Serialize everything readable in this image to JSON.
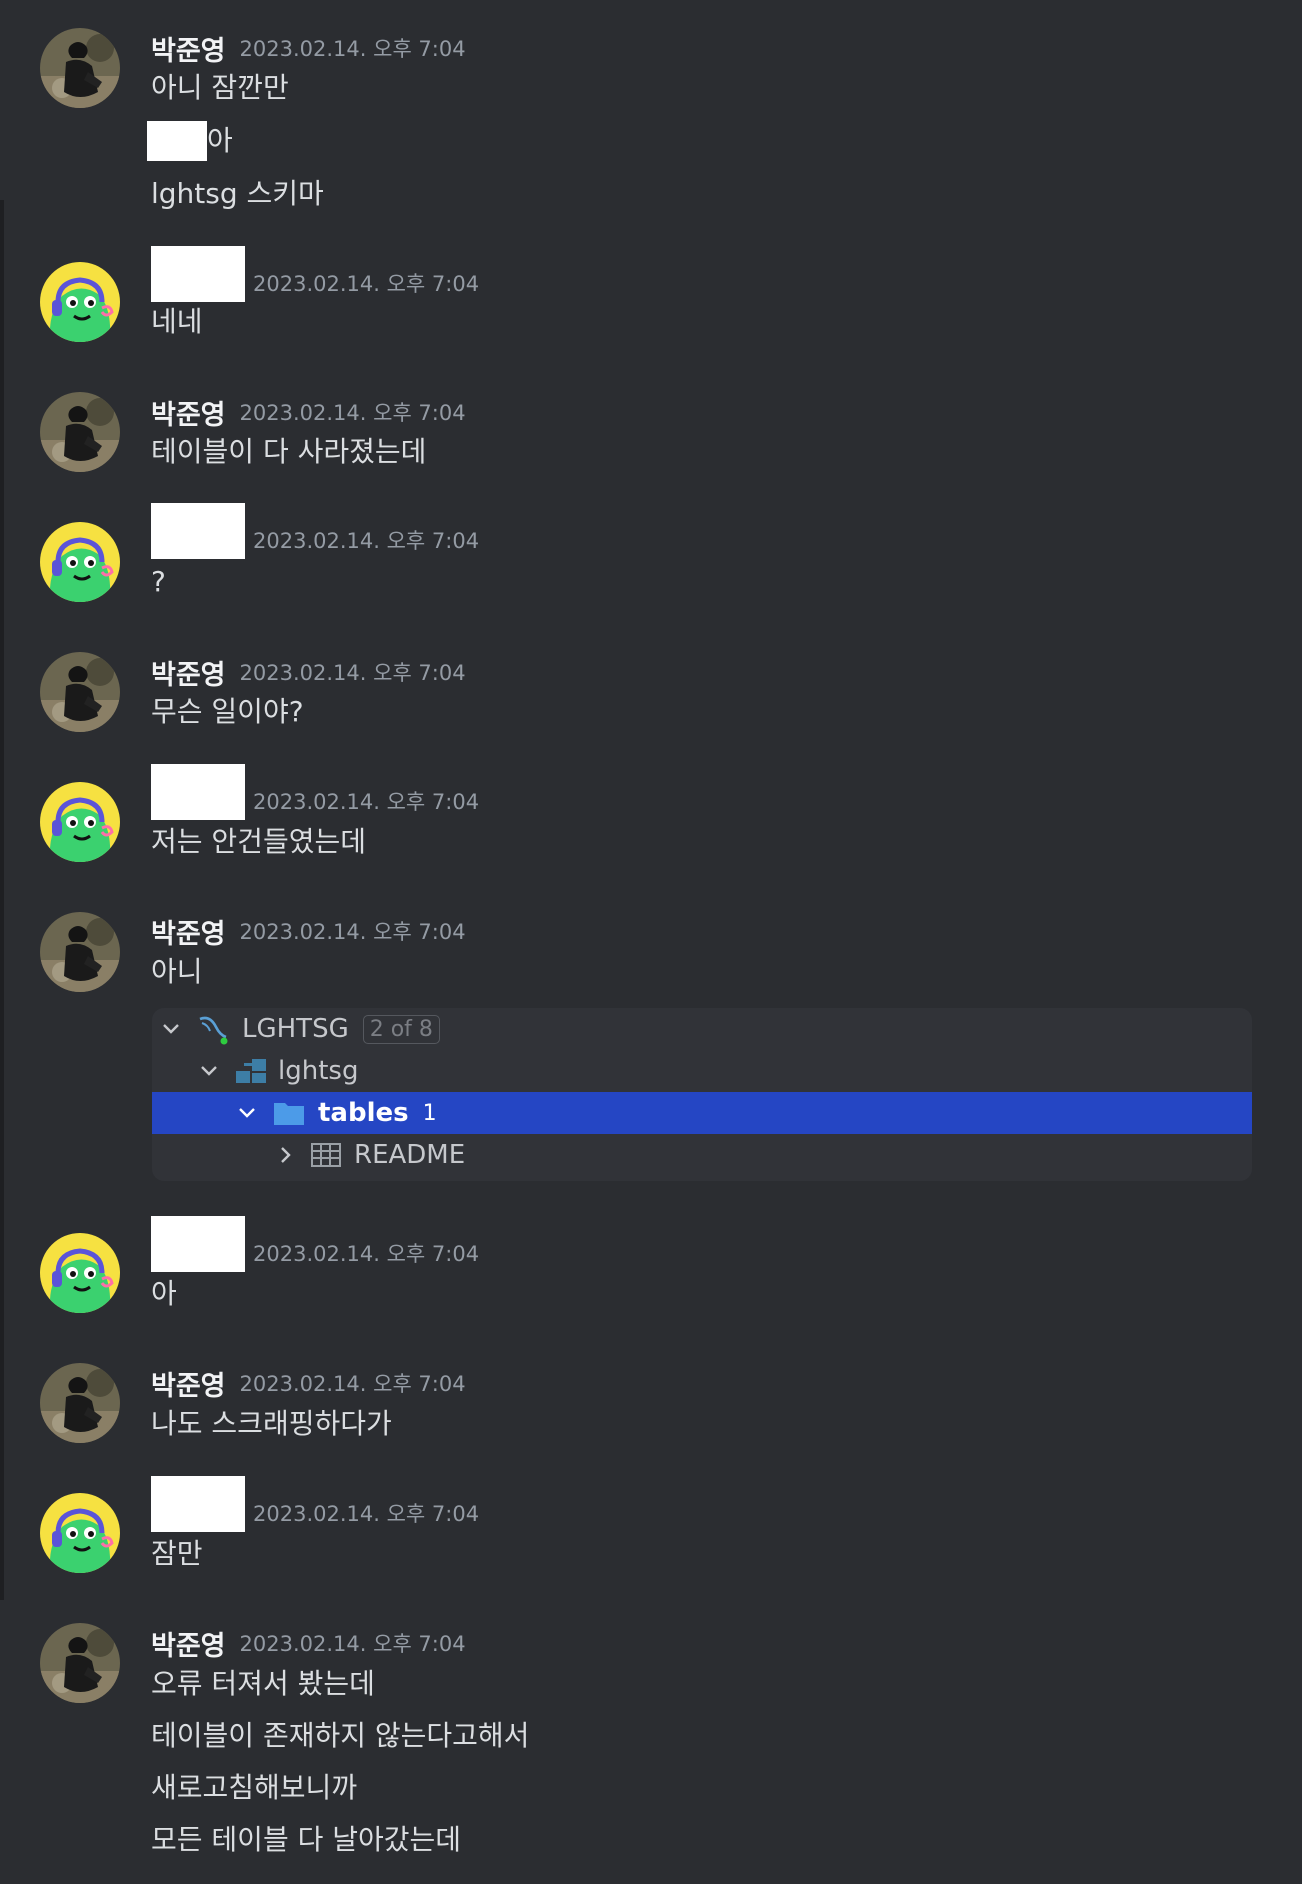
{
  "redact_fill": "#ffffff",
  "messages": [
    {
      "author": "박준영",
      "avatar": "photo-avatar",
      "timestamp": "2023.02.14. 오후 7:04",
      "lines": [
        "아니 잠깐만",
        "아",
        "lghtsg 스키마"
      ]
    },
    {
      "author": "",
      "avatar": "cartoon-avatar",
      "timestamp": "2023.02.14. 오후 7:04",
      "lines": [
        "네네"
      ]
    },
    {
      "author": "박준영",
      "avatar": "photo-avatar",
      "timestamp": "2023.02.14. 오후 7:04",
      "lines": [
        "테이블이 다 사라졌는데"
      ]
    },
    {
      "author": "",
      "avatar": "cartoon-avatar",
      "timestamp": "2023.02.14. 오후 7:04",
      "lines": [
        "?"
      ]
    },
    {
      "author": "박준영",
      "avatar": "photo-avatar",
      "timestamp": "2023.02.14. 오후 7:04",
      "lines": [
        "무슨 일이야?"
      ]
    },
    {
      "author": "",
      "avatar": "cartoon-avatar",
      "timestamp": "2023.02.14. 오후 7:04",
      "lines": [
        "저는 안건들였는데"
      ]
    },
    {
      "author": "박준영",
      "avatar": "photo-avatar",
      "timestamp": "2023.02.14. 오후 7:04",
      "lines": [
        "아니"
      ]
    },
    {
      "author": "",
      "avatar": "cartoon-avatar",
      "timestamp": "2023.02.14. 오후 7:04",
      "lines": [
        "아"
      ]
    },
    {
      "author": "박준영",
      "avatar": "photo-avatar",
      "timestamp": "2023.02.14. 오후 7:04",
      "lines": [
        "나도 스크래핑하다가"
      ]
    },
    {
      "author": "",
      "avatar": "cartoon-avatar",
      "timestamp": "2023.02.14. 오후 7:04",
      "lines": [
        "잠만"
      ]
    },
    {
      "author": "박준영",
      "avatar": "photo-avatar",
      "timestamp": "2023.02.14. 오후 7:04",
      "lines": [
        "오류 터져서 봤는데",
        "테이블이 존재하지 않는다고해서",
        "새로고침해보니까",
        "모든 테이블 다 날아갔는데"
      ]
    }
  ],
  "db_tree": {
    "connection": {
      "label": "LGHTSG",
      "badge": "2 of 8",
      "icon": "mysql-dolphin-icon"
    },
    "schema": {
      "label": "lghtsg",
      "icon": "schema-icon"
    },
    "folder": {
      "label": "tables",
      "count": "1",
      "icon": "folder-icon"
    },
    "table": {
      "label": "README",
      "icon": "table-grid-icon"
    },
    "selected_color": "#2546c4"
  }
}
